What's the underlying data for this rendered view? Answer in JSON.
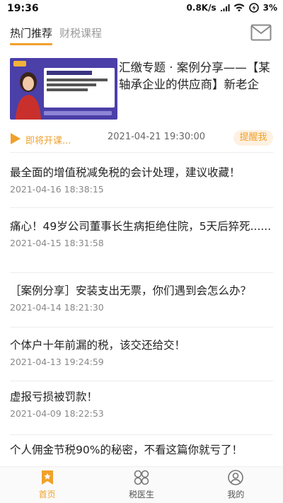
{
  "status_bar": {
    "time": "19:36",
    "network_speed": "0.8K/s",
    "battery": "3%"
  },
  "tabs": [
    {
      "label": "热门推荐",
      "active": true
    },
    {
      "label": "财税课程",
      "active": false
    }
  ],
  "featured": {
    "title": "汇缴专题 · 案例分享——【某轴承企业的供应商】新老企业...",
    "live_status": "即将开课...",
    "time": "2021-04-21 19:30:00",
    "remind_label": "提醒我"
  },
  "articles": [
    {
      "title": "最全面的增值税减免税的会计处理，建议收藏！",
      "date": "2021-04-16 18:38:15"
    },
    {
      "title": "痛心！49岁公司董事长生病拒绝住院，5天后猝死......",
      "date": "2021-04-15 18:31:58"
    },
    {
      "title": "［案例分享］安装支出无票，你们遇到会怎么办？",
      "date": "2021-04-14 18:21:30"
    },
    {
      "title": "个体户十年前漏的税，该交还给交！",
      "date": "2021-04-13 19:24:59"
    },
    {
      "title": "虚报亏损被罚款！",
      "date": "2021-04-09 18:22:53"
    },
    {
      "title": "个人佣金节税90%的秘密，不看这篇你就亏了！",
      "date": ""
    }
  ],
  "bottom_nav": [
    {
      "label": "首页",
      "icon": "home-bookmark-icon",
      "active": true
    },
    {
      "label": "税医生",
      "icon": "grid-icon",
      "active": false
    },
    {
      "label": "我的",
      "icon": "user-icon",
      "active": false
    }
  ],
  "colors": {
    "accent": "#f0a12b",
    "remind_bg": "#fdf1e1",
    "thumbnail_bg": "#4b3fa8"
  }
}
